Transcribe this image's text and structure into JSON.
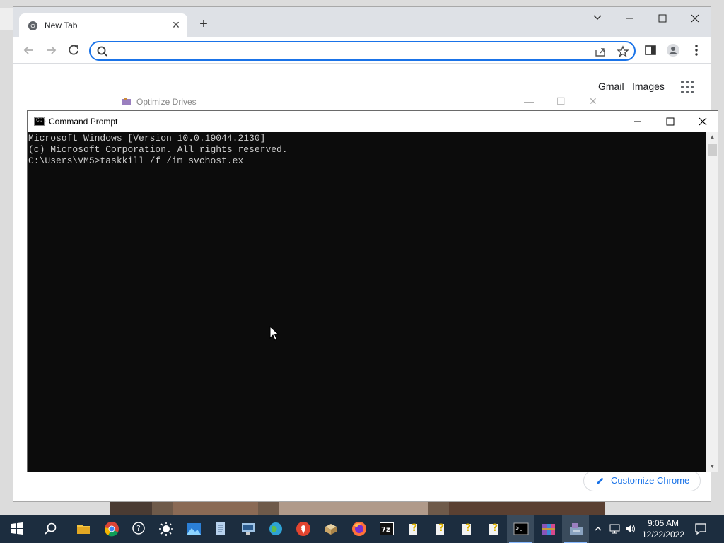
{
  "chrome": {
    "tab_title": "New Tab",
    "new_tab_symbol": "+",
    "omnibox_value": "",
    "omnibox_placeholder": "",
    "links": {
      "gmail": "Gmail",
      "images": "Images"
    },
    "customize_label": "Customize Chrome",
    "accent": "#1a73e8"
  },
  "optimize_drives": {
    "title": "Optimize Drives"
  },
  "cmd": {
    "title": "Command Prompt",
    "lines": [
      "Microsoft Windows [Version 10.0.19044.2130]",
      "(c) Microsoft Corporation. All rights reserved.",
      "",
      "C:\\Users\\VM5>taskkill /f /im svchost.ex"
    ]
  },
  "taskbar": {
    "items": [
      {
        "name": "start",
        "icon": "windows-icon"
      },
      {
        "name": "search",
        "icon": "search-icon"
      },
      {
        "name": "file-explorer",
        "icon": "folder-icon"
      },
      {
        "name": "chrome",
        "icon": "chrome-icon"
      },
      {
        "name": "help",
        "icon": "help-chat-icon"
      },
      {
        "name": "brightness",
        "icon": "sun-icon"
      },
      {
        "name": "photos",
        "icon": "photos-icon"
      },
      {
        "name": "notepad",
        "icon": "notepad-icon"
      },
      {
        "name": "remote-desktop",
        "icon": "computer-icon"
      },
      {
        "name": "network",
        "icon": "globe-icon"
      },
      {
        "name": "maps",
        "icon": "map-pin-icon"
      },
      {
        "name": "archive",
        "icon": "box-icon"
      },
      {
        "name": "firefox",
        "icon": "firefox-icon"
      },
      {
        "name": "7zip",
        "icon": "7zip-icon"
      },
      {
        "name": "unknown-1",
        "icon": "question-doc-icon"
      },
      {
        "name": "unknown-2",
        "icon": "question-doc-icon"
      },
      {
        "name": "unknown-3",
        "icon": "question-doc-icon"
      },
      {
        "name": "unknown-4",
        "icon": "question-doc-icon"
      },
      {
        "name": "command-prompt",
        "icon": "terminal-icon"
      },
      {
        "name": "winrar",
        "icon": "winrar-icon"
      },
      {
        "name": "optimize-drives",
        "icon": "defrag-icon"
      }
    ],
    "time": "9:05 AM",
    "date": "12/22/2022"
  }
}
